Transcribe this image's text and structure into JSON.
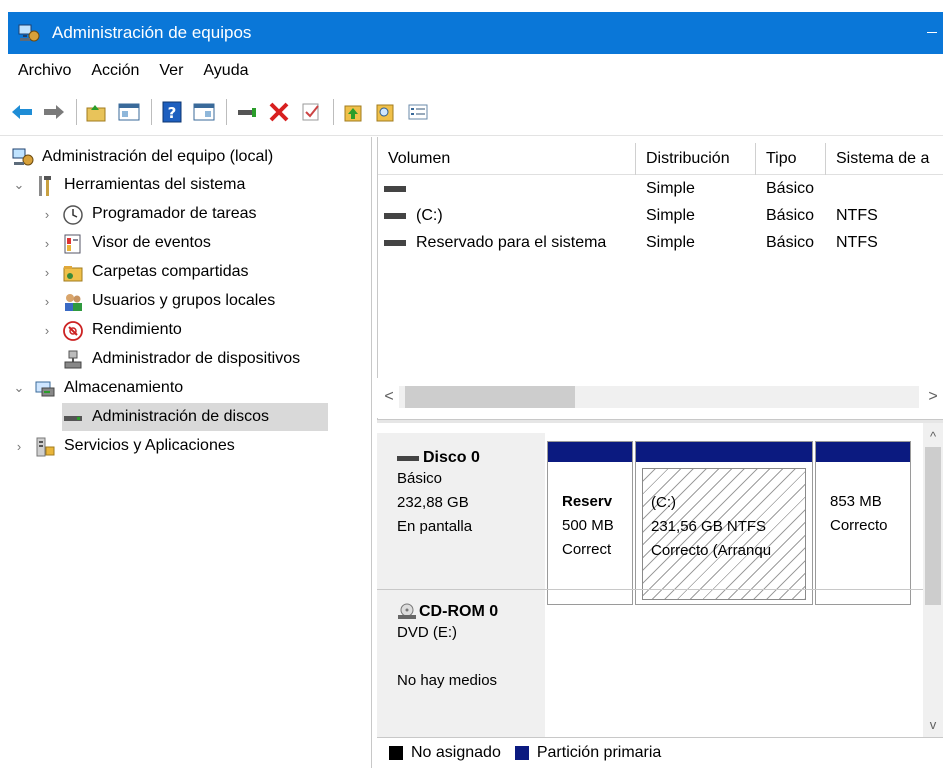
{
  "window": {
    "title": "Administración de equipos"
  },
  "menu": [
    "Archivo",
    "Acción",
    "Ver",
    "Ayuda"
  ],
  "toolbar": {
    "icons": [
      "back-arrow-icon",
      "forward-arrow-icon",
      "up-folder-icon",
      "show-hide-console-tree-icon",
      "help-icon",
      "properties-view-icon",
      "connect-virtual-disk-icon",
      "delete-icon",
      "checkmark-icon",
      "up-arrow-folder-icon",
      "search-folder-icon",
      "list-view-icon"
    ]
  },
  "tree": {
    "root": "Administración del equipo (local)",
    "system_tools": "Herramientas del sistema",
    "task_scheduler": "Programador de tareas",
    "event_viewer": "Visor de eventos",
    "shared_folders": "Carpetas compartidas",
    "local_users": "Usuarios y grupos locales",
    "performance": "Rendimiento",
    "device_manager": "Administrador de dispositivos",
    "storage": "Almacenamiento",
    "disk_management": "Administración de discos",
    "services": "Servicios y Aplicaciones"
  },
  "volumes": {
    "headers": [
      "Volumen",
      "Distribución",
      "Tipo",
      "Sistema de a"
    ],
    "rows": [
      {
        "name": "",
        "layout": "Simple",
        "type": "Básico",
        "fs": ""
      },
      {
        "name": "(C:)",
        "layout": "Simple",
        "type": "Básico",
        "fs": "NTFS"
      },
      {
        "name": "Reservado para el sistema",
        "layout": "Simple",
        "type": "Básico",
        "fs": "NTFS"
      }
    ]
  },
  "disks": {
    "disk0": {
      "name": "Disco 0",
      "type": "Básico",
      "size": "232,88 GB",
      "status": "En pantalla"
    },
    "partitions": [
      {
        "title": "Reserv",
        "size": "500 MB",
        "status": "Correct"
      },
      {
        "title": "(C:)",
        "size": "231,56 GB NTFS",
        "status": "Correcto (Arranqu"
      },
      {
        "title": "",
        "size": "853 MB",
        "status": "Correcto"
      }
    ],
    "cdrom": {
      "name": "CD-ROM 0",
      "drive": "DVD (E:)",
      "status": "No hay medios"
    }
  },
  "legend": {
    "unallocated": "No asignado",
    "primary": "Partición primaria",
    "colors": {
      "unallocated": "#000000",
      "primary": "#0b1a80"
    }
  },
  "scroll": {
    "left": "<",
    "right": ">",
    "up": "^",
    "down": "v"
  }
}
